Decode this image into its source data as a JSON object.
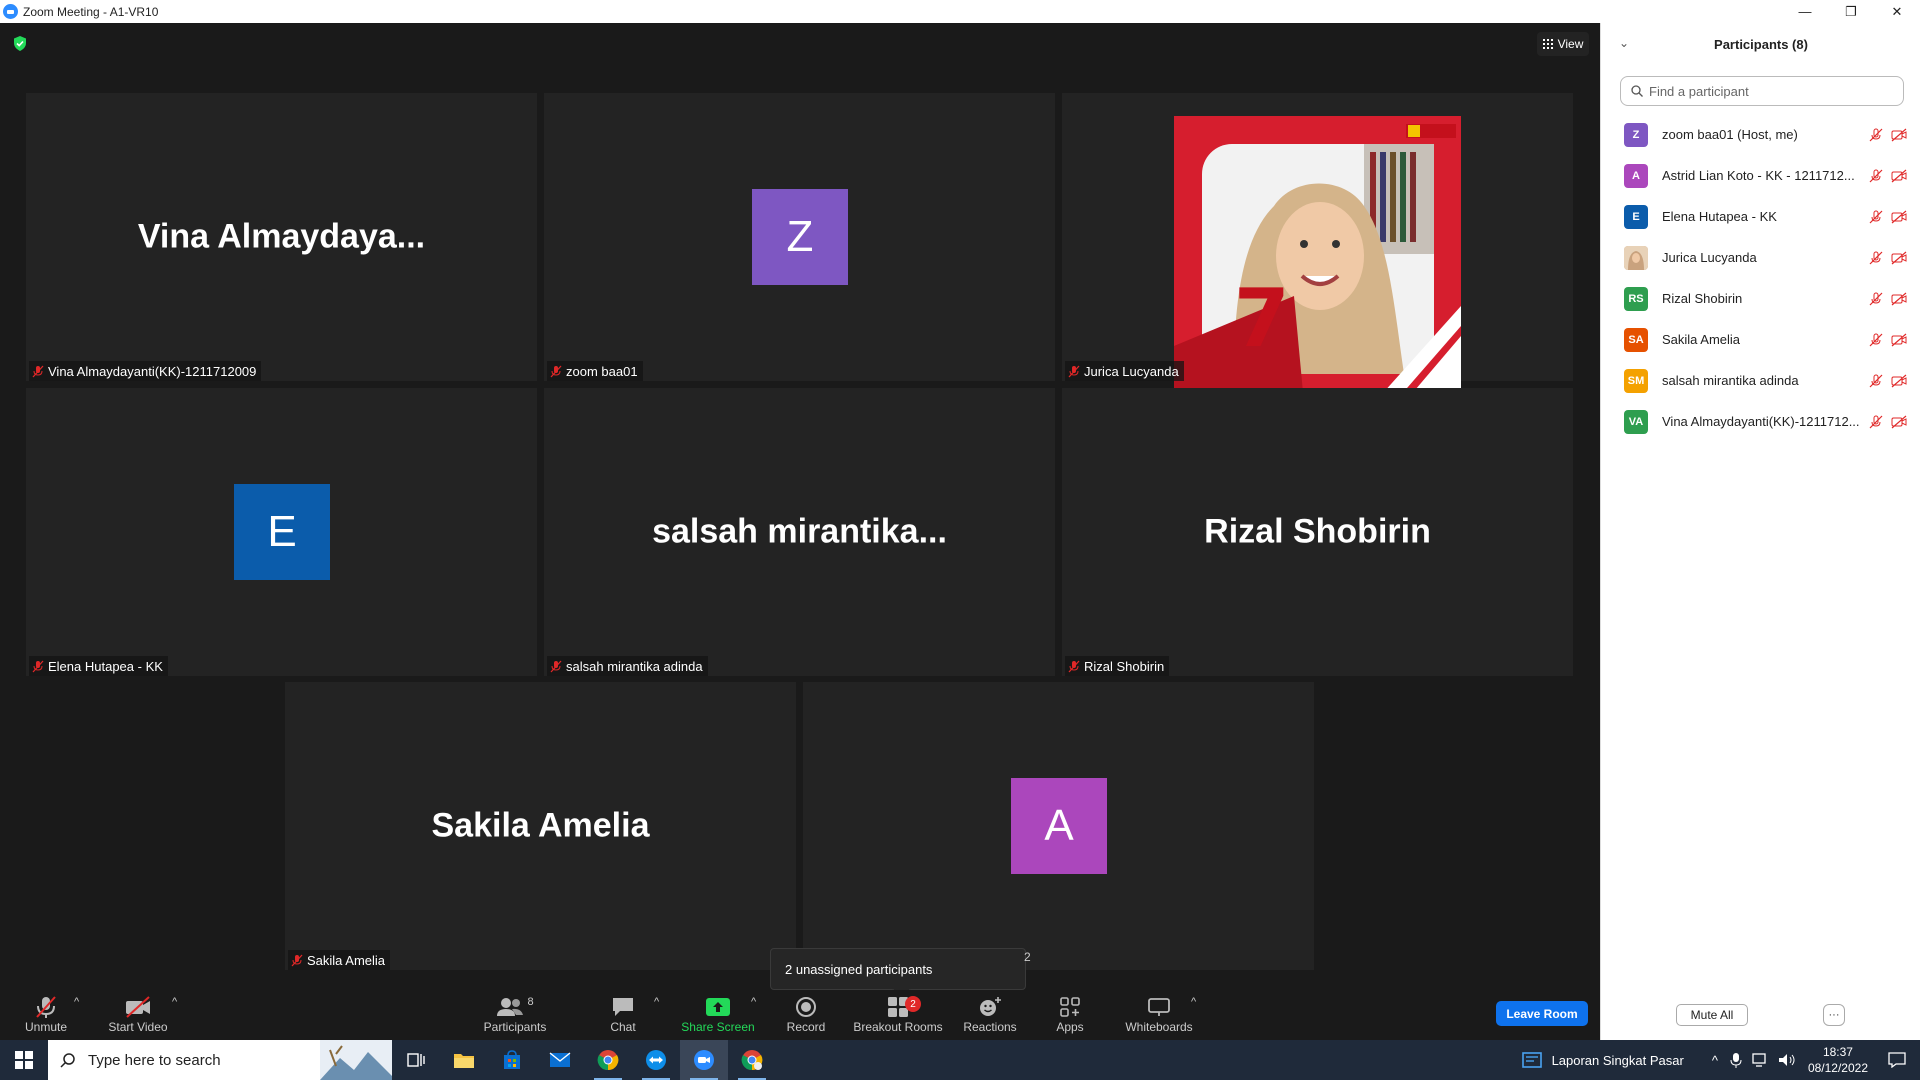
{
  "window": {
    "title": "Zoom Meeting - A1-VR10"
  },
  "meeting": {
    "view_label": "View",
    "tiles": [
      {
        "kind": "name",
        "display": "Vina  Almaydaya...",
        "label": "Vina Almaydayanti(KK)-1211712009"
      },
      {
        "kind": "avatar",
        "initial": "Z",
        "color": "#7e57c2",
        "label": "zoom baa01"
      },
      {
        "kind": "photo",
        "label": "Jurica Lucyanda"
      },
      {
        "kind": "avatar",
        "initial": "E",
        "color": "#0b5cab",
        "label": "Elena Hutapea - KK"
      },
      {
        "kind": "name",
        "display": "salsah  mirantika...",
        "label": "salsah mirantika adinda"
      },
      {
        "kind": "name",
        "display": "Rizal Shobirin",
        "label": "Rizal Shobirin"
      },
      {
        "kind": "name",
        "display": "Sakila Amelia",
        "label": "Sakila Amelia"
      },
      {
        "kind": "avatar",
        "initial": "A",
        "color": "#ab47bc",
        "label": ""
      }
    ],
    "tooltip": "2 unassigned participants",
    "tooltip_badge": "2"
  },
  "toolbar": {
    "unmute": "Unmute",
    "start_video": "Start Video",
    "participants": "Participants",
    "participants_count": "8",
    "chat": "Chat",
    "share_screen": "Share Screen",
    "record": "Record",
    "breakout_rooms": "Breakout Rooms",
    "breakout_badge": "2",
    "reactions": "Reactions",
    "apps": "Apps",
    "whiteboards": "Whiteboards",
    "leave": "Leave Room"
  },
  "panel": {
    "title": "Participants (8)",
    "search_placeholder": "Find a participant",
    "participants": [
      {
        "initials": "Z",
        "color": "#7e57c2",
        "name": "zoom baa01 (Host, me)"
      },
      {
        "initials": "A",
        "color": "#ab47bc",
        "name": "Astrid Lian Koto - KK - 1211712..."
      },
      {
        "initials": "E",
        "color": "#0b5cab",
        "name": "Elena Hutapea - KK"
      },
      {
        "initials": "",
        "color": "#c9a27e",
        "name": "Jurica Lucyanda"
      },
      {
        "initials": "RS",
        "color": "#2e9e4f",
        "name": "Rizal Shobirin"
      },
      {
        "initials": "SA",
        "color": "#e65100",
        "name": "Sakila Amelia"
      },
      {
        "initials": "SM",
        "color": "#f4a100",
        "name": "salsah mirantika adinda"
      },
      {
        "initials": "VA",
        "color": "#2e9e4f",
        "name": "Vina Almaydayanti(KK)-1211712..."
      }
    ],
    "mute_all": "Mute All",
    "more": "···"
  },
  "taskbar": {
    "search_placeholder": "Type here to search",
    "notification_title": "Laporan Singkat Pasar",
    "time": "18:37",
    "date": "08/12/2022"
  }
}
